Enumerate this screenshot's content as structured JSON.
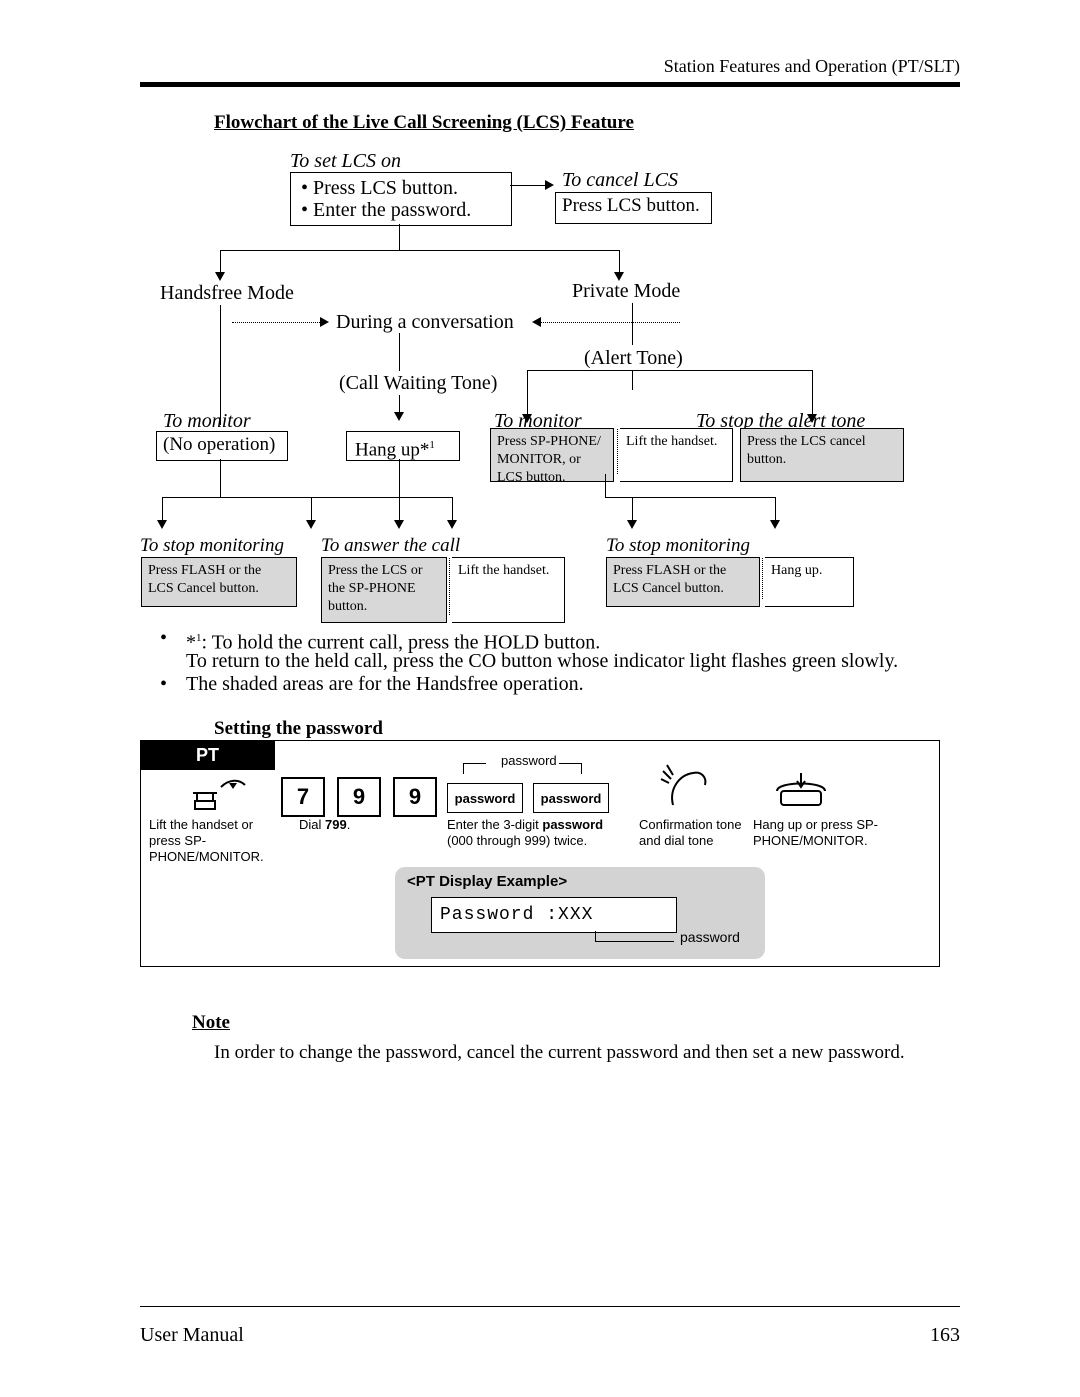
{
  "header": {
    "right": "Station Features and Operation (PT/SLT)"
  },
  "title": "Flowchart of the Live Call Screening (LCS) Feature",
  "flow": {
    "set_on_caption": "To set LCS on",
    "set_on_b1": "Press LCS button.",
    "set_on_b2": "Enter the password.",
    "cancel_caption": "To cancel LCS",
    "cancel_body": "Press LCS button.",
    "handsfree": "Handsfree Mode",
    "private": "Private Mode",
    "during": "During a conversation",
    "alert": "(Alert Tone)",
    "cwt": "(Call Waiting Tone)",
    "monitor": "To monitor",
    "noop": "(No operation)",
    "hangup": "Hang up*",
    "hangup_sup": "1",
    "sp_phone": "Press SP-PHONE/ MONITOR, or LCS button.",
    "lift": "Lift the handset.",
    "stop_alert_caption": "To stop the alert tone",
    "stop_alert_body": "Press the LCS cancel button.",
    "stop_mon": "To stop monitoring",
    "answer": "To answer the call",
    "press_flash": "Press FLASH or the LCS Cancel button.",
    "press_lcs_sp": "Press the LCS or the SP-PHONE button.",
    "lift2": "Lift the handset.",
    "hangup2": "Hang up."
  },
  "bullets": {
    "b1a": "*",
    "b1a_sup": "1",
    "b1b": ": To hold the current call, press the HOLD button.",
    "b1c": "To return to the held call, press the CO button whose indicator light flashes green slowly.",
    "b2": "The shaded areas are for the Handsfree operation."
  },
  "password": {
    "section_title": "Setting the password",
    "tab": "PT",
    "d1": "7",
    "d2": "9",
    "d3": "9",
    "pw_label": "password",
    "cap_lift": "Lift the handset or press SP-PHONE/MONITOR.",
    "cap_dial_a": "Dial ",
    "cap_dial_b": "799",
    "cap_dial_c": ".",
    "cap_enter_a": "Enter the 3-digit ",
    "cap_enter_b": "password",
    "cap_enter_c": " (000 through 999) twice.",
    "cap_tone": "Confirmation tone and dial tone",
    "cap_hang": "Hang up or press SP-PHONE/MONITOR.",
    "bracket_label": "password",
    "disp_title": "<PT Display Example>",
    "disp_text": "Password :XXX",
    "disp_label": "password"
  },
  "note": {
    "title": "Note",
    "body": "In order to change the password, cancel the current password and then set a new password."
  },
  "footer": {
    "left": "User Manual",
    "page": "163"
  }
}
